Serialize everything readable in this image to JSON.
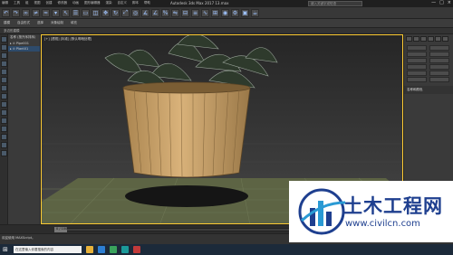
{
  "window": {
    "title": "Autodesk 3ds Max 2017    13.max",
    "search_placeholder": "键入关键字或短语",
    "controls": [
      "—",
      "□",
      "×"
    ]
  },
  "menu": [
    "编辑",
    "工具",
    "组",
    "视图",
    "创建",
    "修改器",
    "动画",
    "图形编辑器",
    "渲染",
    "自定义",
    "脚本",
    "帮助"
  ],
  "toolbar2": [
    "建模",
    "自由形式",
    "选择",
    "对象绘制",
    "填充"
  ],
  "toolbar3": [
    "多边形建模"
  ],
  "scene_explorer": {
    "items": [
      "名称 (按升序排序)",
      "▸ ⊙ Pipe001",
      "▸ ⊙ Plant01"
    ]
  },
  "viewport": {
    "label": "[+] [透视] [标准] [默认明暗处理]"
  },
  "command_panel": {
    "buttons": [
      "",
      "",
      "",
      "",
      "",
      "",
      "",
      "",
      "",
      "",
      "",
      ""
    ],
    "section": "名称和颜色"
  },
  "timeline": {
    "frame": "0 / 100"
  },
  "status": {
    "text": "欢迎使用 MAXScript。"
  },
  "taskbar": {
    "search": "在这里输入你要搜索的内容"
  },
  "watermark": {
    "brand": "土木工程网",
    "url": "www.civilcn.com"
  },
  "colors": {
    "pot": "#c9a066",
    "ground": "#636b4a",
    "viewport_border": "#ffcc33",
    "watermark_text": "#1e3f8f"
  }
}
